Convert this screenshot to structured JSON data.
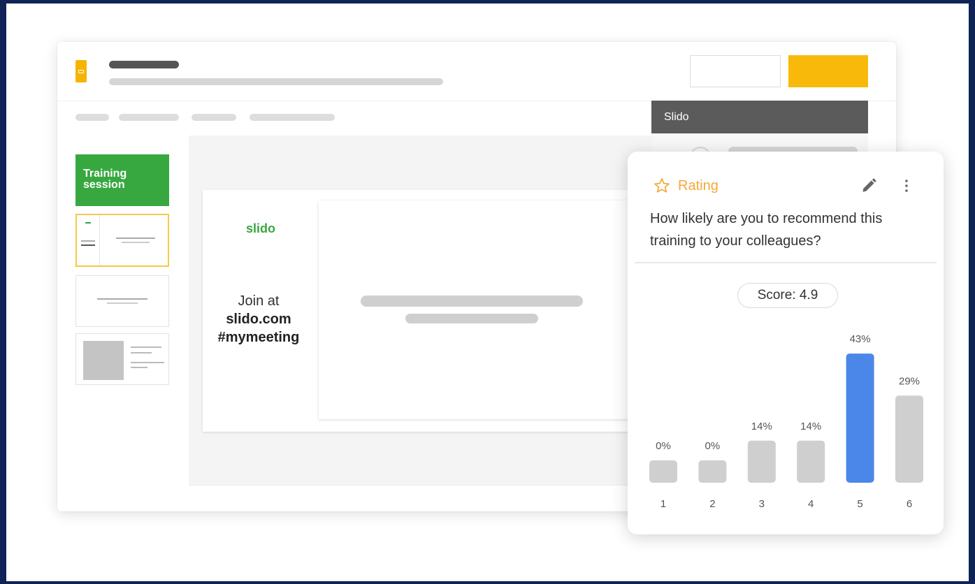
{
  "slido_panel": {
    "title": "Slido"
  },
  "slides": [
    {
      "title": "Training session"
    }
  ],
  "slide": {
    "logo": "slido",
    "join_line1": "Join at",
    "join_line2": "slido.com",
    "join_line3": "#mymeeting"
  },
  "poll": {
    "type_label": "Rating",
    "question": "How likely are you to recommend this training to your colleagues?",
    "score": "Score: 4.9",
    "icons": [
      "star-icon",
      "pencil-icon",
      "more-vertical-icon"
    ]
  },
  "chart_data": {
    "type": "bar",
    "categories": [
      "1",
      "2",
      "3",
      "4",
      "5",
      "6"
    ],
    "values": [
      0,
      0,
      14,
      14,
      43,
      29
    ],
    "value_labels": [
      "0%",
      "0%",
      "14%",
      "14%",
      "43%",
      "29%"
    ],
    "highlight_index": 4,
    "colors": {
      "bar": "#cfcfcf",
      "highlight": "#4b87e8"
    }
  },
  "colors": {
    "frame": "#0f2356",
    "accent_yellow": "#f8b90a",
    "slido_green": "#37a840",
    "rating_orange": "#f4a83a"
  }
}
